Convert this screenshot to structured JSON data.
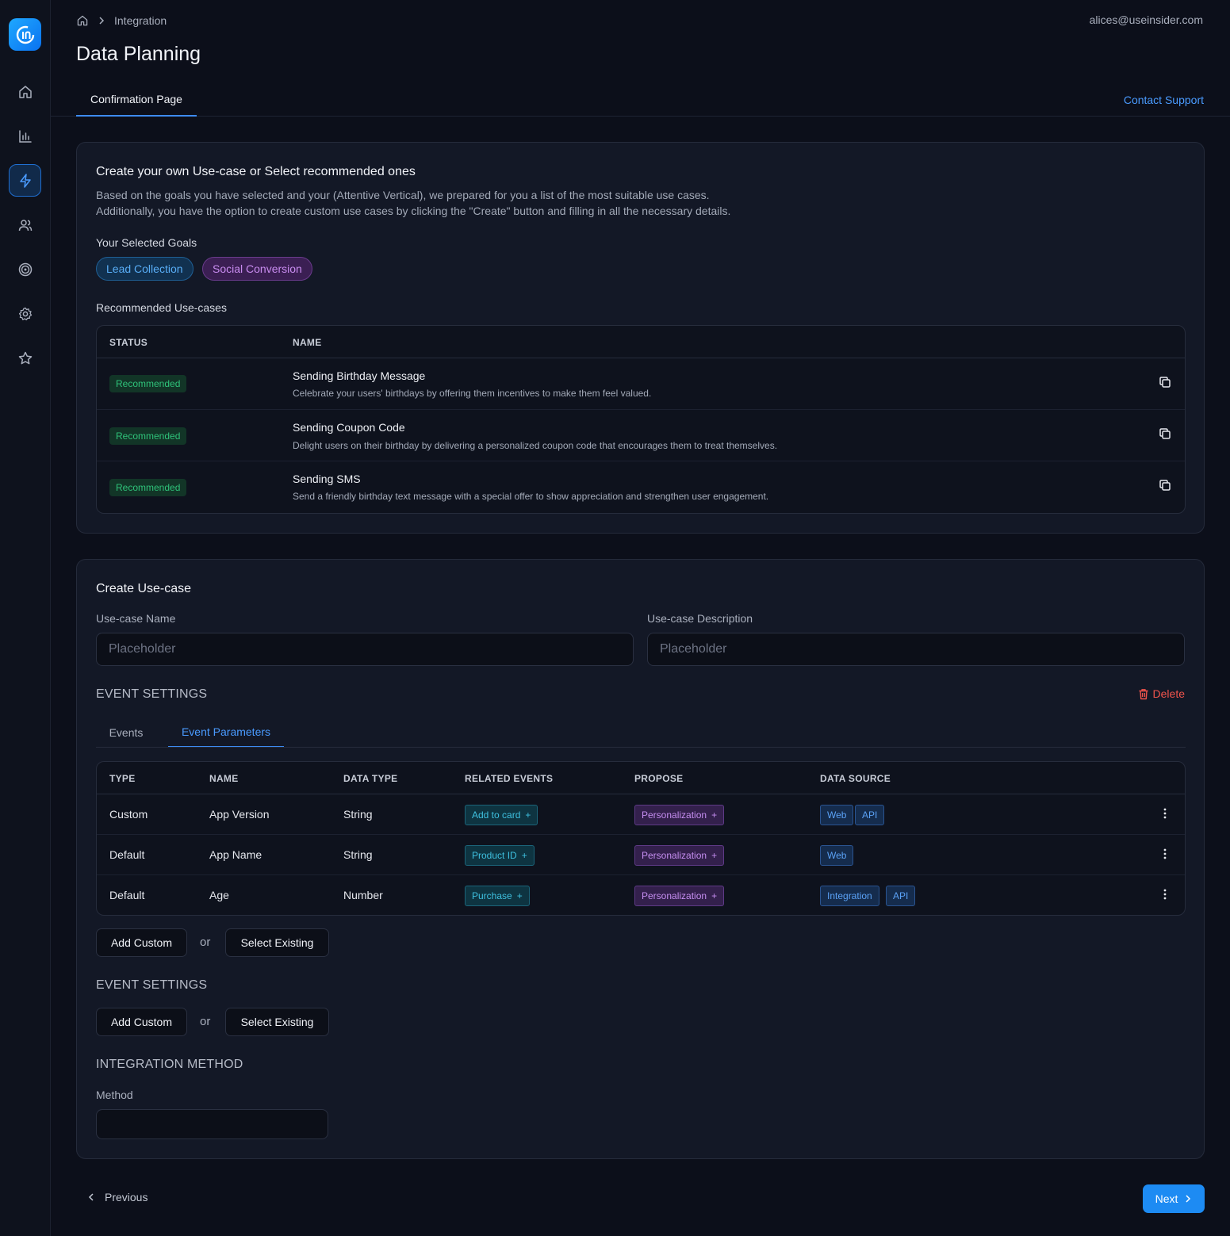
{
  "header": {
    "breadcrumb_current": "Integration",
    "user_email": "alices@useinsider.com",
    "page_title": "Data Planning",
    "tab_label": "Confirmation Page",
    "contact_support": "Contact Support"
  },
  "recommend": {
    "title": "Create your own Use-case or Select recommended ones",
    "description_line1": "Based on the goals you have selected and your (Attentive Vertical), we prepared for you a list of the most suitable use cases.",
    "description_line2": "Additionally, you have the option to create custom use cases by clicking the \"Create\" button and filling in all the necessary details.",
    "goals_label": "Your Selected Goals",
    "goals": [
      "Lead Collection",
      "Social Conversion"
    ],
    "usecases_label": "Recommended Use-cases",
    "columns": [
      "STATUS",
      "NAME"
    ],
    "rows": [
      {
        "status": "Recommended",
        "name": "Sending Birthday Message",
        "description": "Celebrate your users' birthdays by offering them incentives to make them feel valued."
      },
      {
        "status": "Recommended",
        "name": "Sending Coupon Code",
        "description": "Delight users on their birthday by delivering a personalized coupon code that encourages them to treat themselves."
      },
      {
        "status": "Recommended",
        "name": "Sending SMS",
        "description": "Send a friendly birthday text message with a special offer to show appreciation and strengthen user engagement."
      }
    ]
  },
  "create": {
    "title": "Create Use-case",
    "name_label": "Use-case Name",
    "name_placeholder": "Placeholder",
    "desc_label": "Use-case Description",
    "desc_placeholder": "Placeholder",
    "event_settings_title": "EVENT SETTINGS",
    "delete_label": "Delete",
    "tabs": [
      "Events",
      "Event Parameters"
    ],
    "param_columns": [
      "TYPE",
      "NAME",
      "DATA TYPE",
      "RELATED EVENTS",
      "PROPOSE",
      "DATA SOURCE"
    ],
    "params": [
      {
        "type": "Custom",
        "name": "App Version",
        "data_type": "String",
        "related_event": "Add to card",
        "propose": "Personalization",
        "sources": [
          "Web",
          "API"
        ]
      },
      {
        "type": "Default",
        "name": "App Name",
        "data_type": "String",
        "related_event": "Product ID",
        "propose": "Personalization",
        "sources": [
          "Web"
        ]
      },
      {
        "type": "Default",
        "name": "Age",
        "data_type": "Number",
        "related_event": "Purchase",
        "propose": "Personalization",
        "sources": [
          "Integration",
          "API"
        ]
      }
    ],
    "add_custom": "Add Custom",
    "or_text": "or",
    "select_existing": "Select Existing",
    "event_settings_title_2": "EVENT SETTINGS",
    "integration_title": "INTEGRATION METHOD",
    "method_label": "Method",
    "method_value": ""
  },
  "footer": {
    "previous": "Previous",
    "next": "Next"
  },
  "colors": {
    "accent": "#1d8bf3",
    "recommended_badge": "#2fc37a",
    "delete": "#f0544c"
  },
  "icons": {
    "sidebar": [
      "home-icon",
      "chart-icon",
      "lightning-icon",
      "users-icon",
      "target-icon",
      "gear-icon",
      "star-icon"
    ]
  }
}
